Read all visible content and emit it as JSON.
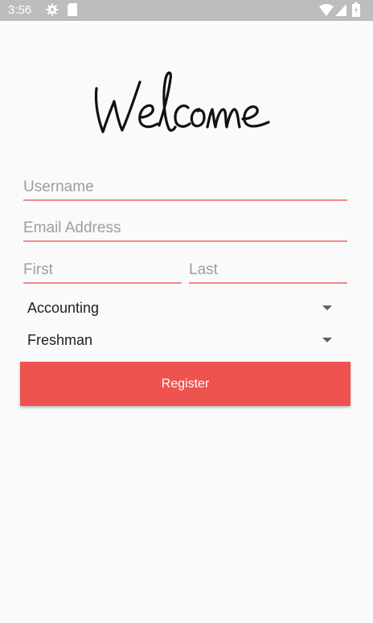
{
  "status_bar": {
    "time": "3:56",
    "icons": [
      "settings-icon",
      "sd-card-icon",
      "wifi-icon",
      "signal-icon",
      "battery-icon"
    ]
  },
  "header": {
    "logo_text": "Welcome"
  },
  "form": {
    "username": {
      "placeholder": "Username",
      "value": ""
    },
    "email": {
      "placeholder": "Email Address",
      "value": ""
    },
    "first_name": {
      "placeholder": "First",
      "value": ""
    },
    "last_name": {
      "placeholder": "Last",
      "value": ""
    },
    "major": {
      "selected": "Accounting"
    },
    "year": {
      "selected": "Freshman"
    },
    "register_label": "Register"
  },
  "colors": {
    "accent": "#ef5350",
    "underline": "#ef8a88",
    "status_bar": "#bdbdbd",
    "background": "#fafafa"
  }
}
